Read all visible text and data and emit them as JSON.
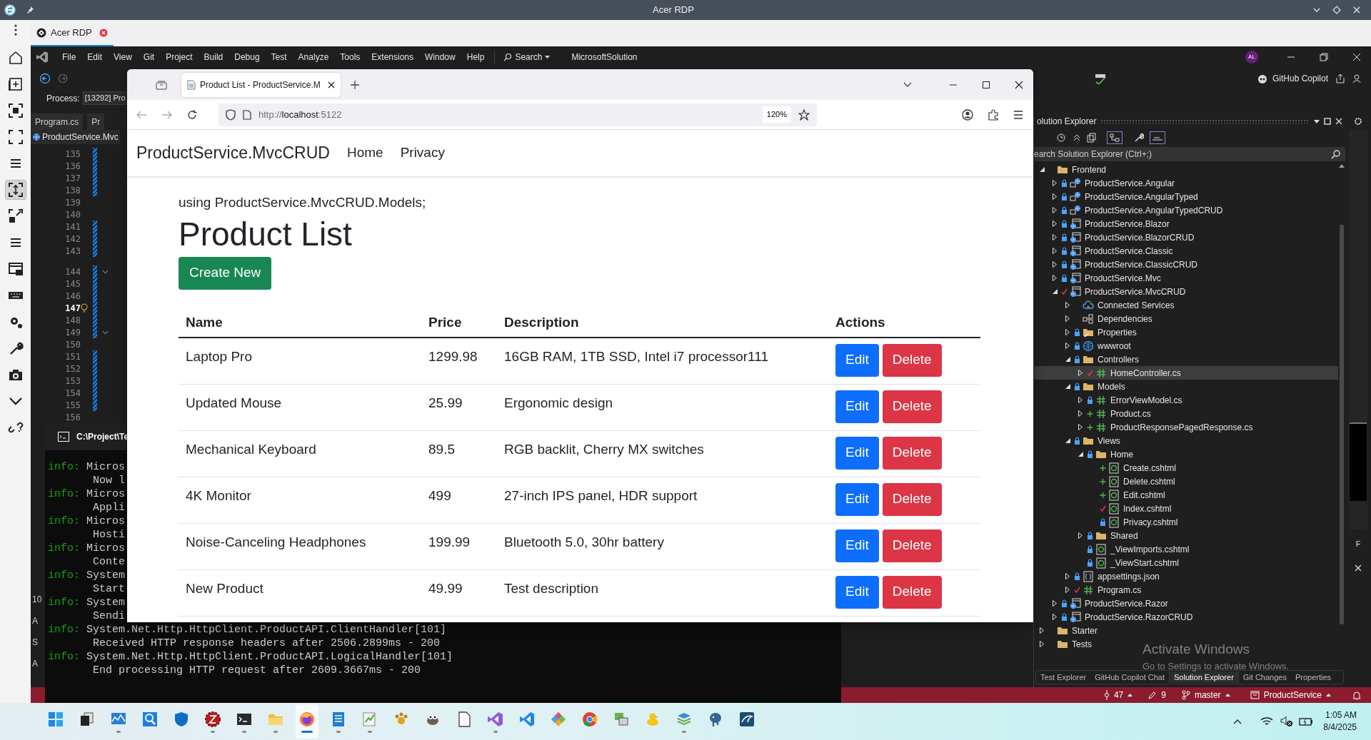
{
  "rdp": {
    "title": "Acer RDP",
    "tab_label": "Acer RDP",
    "toolbar": [
      {
        "kind": "home",
        "selected": false
      },
      {
        "kind": "add",
        "selected": false
      },
      {
        "kind": "focus",
        "selected": false
      },
      {
        "kind": "frame",
        "selected": false
      },
      {
        "kind": "lines",
        "selected": false
      },
      {
        "kind": "fit",
        "selected": true
      },
      {
        "kind": "expand",
        "selected": false
      },
      {
        "kind": "lines",
        "selected": false
      },
      {
        "kind": "windows",
        "selected": false
      },
      {
        "kind": "keyboard",
        "selected": false
      },
      {
        "kind": "gears",
        "selected": false
      },
      {
        "kind": "wrench",
        "selected": false
      },
      {
        "kind": "camera",
        "selected": false
      },
      {
        "kind": "chevron",
        "selected": false
      },
      {
        "kind": "link",
        "selected": false
      }
    ]
  },
  "vs": {
    "menu": [
      "File",
      "Edit",
      "View",
      "Git",
      "Project",
      "Build",
      "Debug",
      "Test",
      "Analyze",
      "Tools",
      "Extensions",
      "Window",
      "Help"
    ],
    "search": "Search",
    "solution_name": "MicrosoftSolution",
    "avatar": "AL",
    "copilot": "GitHub Copilot",
    "process_label": "Process:",
    "process_value": "[13292] Pro",
    "doc_tabs": [
      "Program.cs",
      "Pr"
    ],
    "file_tab": "ProductService.Mvc",
    "line_numbers": [
      {
        "number": "135",
        "changed": true,
        "current": false,
        "foldable": false
      },
      {
        "number": "136",
        "changed": true,
        "current": false,
        "foldable": false
      },
      {
        "number": "137",
        "changed": true,
        "current": false,
        "foldable": false
      },
      {
        "number": "138",
        "changed": true,
        "current": false,
        "foldable": false
      },
      {
        "number": "139",
        "changed": false,
        "current": false,
        "foldable": false
      },
      {
        "number": "140",
        "changed": false,
        "current": false,
        "foldable": false
      },
      {
        "number": "141",
        "changed": true,
        "current": false,
        "foldable": false
      },
      {
        "number": "142",
        "changed": true,
        "current": false,
        "foldable": false
      },
      {
        "number": "143",
        "changed": true,
        "current": false,
        "foldable": false
      },
      {
        "number": "144",
        "changed": true,
        "current": false,
        "foldable": true
      },
      {
        "number": "145",
        "changed": true,
        "current": false,
        "foldable": false
      },
      {
        "number": "146",
        "changed": true,
        "current": false,
        "foldable": false
      },
      {
        "number": "147",
        "changed": true,
        "current": true,
        "foldable": false
      },
      {
        "number": "148",
        "changed": true,
        "current": false,
        "foldable": false
      },
      {
        "number": "149",
        "changed": true,
        "current": false,
        "foldable": true
      },
      {
        "number": "150",
        "changed": false,
        "current": false,
        "foldable": false
      },
      {
        "number": "151",
        "changed": true,
        "current": false,
        "foldable": false
      },
      {
        "number": "152",
        "changed": true,
        "current": false,
        "foldable": false
      },
      {
        "number": "153",
        "changed": true,
        "current": false,
        "foldable": false
      },
      {
        "number": "154",
        "changed": true,
        "current": false,
        "foldable": false
      },
      {
        "number": "155",
        "changed": true,
        "current": false,
        "foldable": false
      },
      {
        "number": "156",
        "changed": false,
        "current": false,
        "foldable": false
      }
    ],
    "hidden_panel_fragments": [
      "10",
      "A",
      "S",
      "A"
    ],
    "right_fragment": "F"
  },
  "browser": {
    "tab_title": "Product List - ProductService.M",
    "url_prefix": "http://",
    "url_host": "localhost",
    "url_port": ":5122",
    "zoom": "120%",
    "page": {
      "brand": "ProductService.MvcCRUD",
      "nav": [
        "Home",
        "Privacy"
      ],
      "using_line": "using ProductService.MvcCRUD.Models;",
      "heading": "Product List",
      "create_button": "Create New",
      "columns": [
        "Name",
        "Price",
        "Description",
        "Actions"
      ],
      "rows": [
        {
          "name": "Laptop Pro",
          "price": "1299.98",
          "description": "16GB RAM, 1TB SSD, Intel i7 processor111",
          "actions": [
            "Edit",
            "Delete"
          ]
        },
        {
          "name": "Updated Mouse",
          "price": "25.99",
          "description": "Ergonomic design",
          "actions": [
            "Edit",
            "Delete"
          ]
        },
        {
          "name": "Mechanical Keyboard",
          "price": "89.5",
          "description": "RGB backlit, Cherry MX switches",
          "actions": [
            "Edit",
            "Delete"
          ]
        },
        {
          "name": "4K Monitor",
          "price": "499",
          "description": "27-inch IPS panel, HDR support",
          "actions": [
            "Edit",
            "Delete"
          ]
        },
        {
          "name": "Noise-Canceling Headphones",
          "price": "199.99",
          "description": "Bluetooth 5.0, 30hr battery",
          "actions": [
            "Edit",
            "Delete"
          ]
        },
        {
          "name": "New Product",
          "price": "49.99",
          "description": "Test description",
          "actions": [
            "Edit",
            "Delete"
          ]
        }
      ]
    }
  },
  "terminal": {
    "title": "C:\\Project\\Te",
    "entries": [
      {
        "level": "info:",
        "source": "Micros",
        "message": "Now l"
      },
      {
        "level": "info:",
        "source": "Micros",
        "message": "Appli"
      },
      {
        "level": "info:",
        "source": "Micros",
        "message": "Hosti"
      },
      {
        "level": "info:",
        "source": "Micros",
        "message": "Conte"
      },
      {
        "level": "info:",
        "source": "System",
        "message": "Start"
      },
      {
        "level": "info:",
        "source": "System",
        "message": "Sendi"
      },
      {
        "level": "info:",
        "source": "System.Net.Http.HttpClient.ProductAPI.ClientHandler[101]",
        "message": "Received HTTP response headers after 2506.2899ms - 200"
      },
      {
        "level": "info:",
        "source": "System.Net.Http.HttpClient.ProductAPI.LogicalHandler[101]",
        "message": "End processing HTTP request after 2609.3667ms - 200"
      }
    ]
  },
  "solution_explorer": {
    "title": "olution Explorer",
    "search_placeholder": "earch Solution Explorer (Ctrl+;)",
    "tree": [
      {
        "label": "Frontend",
        "kind": "folder",
        "locked": false,
        "modified": false,
        "added": false,
        "selected": false,
        "expanded": true,
        "children": [
          {
            "label": "ProductService.Angular",
            "kind": "web-project",
            "locked": true,
            "modified": false,
            "added": false,
            "selected": false,
            "expanded": false
          },
          {
            "label": "ProductService.AngularTyped",
            "kind": "web-project",
            "locked": true,
            "modified": false,
            "added": false,
            "selected": false,
            "expanded": false
          },
          {
            "label": "ProductService.AngularTypedCRUD",
            "kind": "web-project",
            "locked": true,
            "modified": false,
            "added": false,
            "selected": false,
            "expanded": false
          },
          {
            "label": "ProductService.Blazor",
            "kind": "project",
            "locked": true,
            "modified": false,
            "added": false,
            "selected": false,
            "expanded": false
          },
          {
            "label": "ProductService.BlazorCRUD",
            "kind": "project",
            "locked": true,
            "modified": false,
            "added": false,
            "selected": false,
            "expanded": false
          },
          {
            "label": "ProductService.Classic",
            "kind": "project",
            "locked": true,
            "modified": false,
            "added": false,
            "selected": false,
            "expanded": false
          },
          {
            "label": "ProductService.ClassicCRUD",
            "kind": "project",
            "locked": true,
            "modified": false,
            "added": false,
            "selected": false,
            "expanded": false
          },
          {
            "label": "ProductService.Mvc",
            "kind": "project",
            "locked": true,
            "modified": false,
            "added": false,
            "selected": false,
            "expanded": false
          },
          {
            "label": "ProductService.MvcCRUD",
            "kind": "project",
            "locked": false,
            "modified": true,
            "added": false,
            "selected": false,
            "expanded": true,
            "children": [
              {
                "label": "Connected Services",
                "kind": "cloud",
                "locked": false,
                "modified": false,
                "added": false,
                "selected": false,
                "expanded": false
              },
              {
                "label": "Dependencies",
                "kind": "dependencies",
                "locked": false,
                "modified": false,
                "added": false,
                "selected": false,
                "expanded": false
              },
              {
                "label": "Properties",
                "kind": "properties",
                "locked": true,
                "modified": false,
                "added": false,
                "selected": false,
                "expanded": false
              },
              {
                "label": "wwwroot",
                "kind": "globe",
                "locked": true,
                "modified": false,
                "added": false,
                "selected": false,
                "expanded": false
              },
              {
                "label": "Controllers",
                "kind": "folder",
                "locked": true,
                "modified": false,
                "added": false,
                "selected": false,
                "expanded": true,
                "children": [
                  {
                    "label": "HomeController.cs",
                    "kind": "csharp",
                    "locked": false,
                    "modified": true,
                    "added": false,
                    "selected": true,
                    "expanded": false
                  }
                ]
              },
              {
                "label": "Models",
                "kind": "folder",
                "locked": true,
                "modified": false,
                "added": false,
                "selected": false,
                "expanded": true,
                "children": [
                  {
                    "label": "ErrorViewModel.cs",
                    "kind": "csharp",
                    "locked": true,
                    "modified": false,
                    "added": false,
                    "selected": false,
                    "expanded": false
                  },
                  {
                    "label": "Product.cs",
                    "kind": "csharp",
                    "locked": false,
                    "modified": false,
                    "added": true,
                    "selected": false,
                    "expanded": false
                  },
                  {
                    "label": "ProductResponsePagedResponse.cs",
                    "kind": "csharp",
                    "locked": false,
                    "modified": false,
                    "added": true,
                    "selected": false,
                    "expanded": false
                  }
                ]
              },
              {
                "label": "Views",
                "kind": "folder",
                "locked": true,
                "modified": false,
                "added": false,
                "selected": false,
                "expanded": true,
                "children": [
                  {
                    "label": "Home",
                    "kind": "folder",
                    "locked": true,
                    "modified": false,
                    "added": false,
                    "selected": false,
                    "expanded": true,
                    "children": [
                      {
                        "label": "Create.cshtml",
                        "kind": "razor",
                        "locked": false,
                        "modified": false,
                        "added": true,
                        "selected": false
                      },
                      {
                        "label": "Delete.cshtml",
                        "kind": "razor",
                        "locked": false,
                        "modified": false,
                        "added": true,
                        "selected": false
                      },
                      {
                        "label": "Edit.cshtml",
                        "kind": "razor",
                        "locked": false,
                        "modified": false,
                        "added": true,
                        "selected": false
                      },
                      {
                        "label": "Index.cshtml",
                        "kind": "razor",
                        "locked": false,
                        "modified": true,
                        "added": false,
                        "selected": false
                      },
                      {
                        "label": "Privacy.cshtml",
                        "kind": "razor",
                        "locked": true,
                        "modified": false,
                        "added": false,
                        "selected": false
                      }
                    ]
                  },
                  {
                    "label": "Shared",
                    "kind": "folder",
                    "locked": true,
                    "modified": false,
                    "added": false,
                    "selected": false,
                    "expanded": false
                  },
                  {
                    "label": "_ViewImports.cshtml",
                    "kind": "razor",
                    "locked": true,
                    "modified": false,
                    "added": false,
                    "selected": false
                  },
                  {
                    "label": "_ViewStart.cshtml",
                    "kind": "razor",
                    "locked": true,
                    "modified": false,
                    "added": false,
                    "selected": false
                  }
                ]
              },
              {
                "label": "appsettings.json",
                "kind": "json",
                "locked": true,
                "modified": false,
                "added": false,
                "selected": false,
                "expanded": false
              },
              {
                "label": "Program.cs",
                "kind": "csharp",
                "locked": false,
                "modified": true,
                "added": false,
                "selected": false,
                "expanded": false
              }
            ]
          },
          {
            "label": "ProductService.Razor",
            "kind": "project",
            "locked": true,
            "modified": false,
            "added": false,
            "selected": false,
            "expanded": false
          },
          {
            "label": "ProductService.RazorCRUD",
            "kind": "project",
            "locked": true,
            "modified": false,
            "added": false,
            "selected": false,
            "expanded": false
          }
        ]
      },
      {
        "label": "Starter",
        "kind": "folder",
        "locked": false,
        "modified": false,
        "added": false,
        "selected": false,
        "expanded": false
      },
      {
        "label": "Tests",
        "kind": "folder",
        "locked": false,
        "modified": false,
        "added": false,
        "selected": false,
        "expanded": false
      }
    ],
    "bottom_tabs": [
      {
        "label": "Test Explorer",
        "selected": false
      },
      {
        "label": "GitHub Copilot Chat",
        "selected": false
      },
      {
        "label": "Solution Explorer",
        "selected": true
      },
      {
        "label": "Git Changes",
        "selected": false
      },
      {
        "label": "Properties",
        "selected": false
      }
    ]
  },
  "activation_notice": {
    "title": "Activate Windows",
    "message": "Go to Settings to activate Windows."
  },
  "status_bar": {
    "commits": "47",
    "changes": "9",
    "branch": "master",
    "repository": "ProductService"
  },
  "taskbar": {
    "apps": [
      {
        "kind": "start",
        "running": false,
        "selected": false
      },
      {
        "kind": "task-view",
        "running": false,
        "selected": false
      },
      {
        "kind": "monitor",
        "running": true,
        "selected": false
      },
      {
        "kind": "search",
        "running": false,
        "selected": false
      },
      {
        "kind": "shield",
        "running": false,
        "selected": false
      },
      {
        "kind": "ftp",
        "running": true,
        "selected": false
      },
      {
        "kind": "terminal",
        "running": true,
        "selected": false
      },
      {
        "kind": "folder",
        "running": true,
        "selected": false
      },
      {
        "kind": "firefox",
        "running": true,
        "selected": true
      },
      {
        "kind": "notepad",
        "running": true,
        "selected": false
      },
      {
        "kind": "notepad-plus",
        "running": true,
        "selected": false
      },
      {
        "kind": "paw",
        "running": false,
        "selected": false
      },
      {
        "kind": "gimp",
        "running": false,
        "selected": false
      },
      {
        "kind": "document",
        "running": false,
        "selected": false
      },
      {
        "kind": "visual-studio",
        "running": true,
        "selected": false
      },
      {
        "kind": "vscode",
        "running": false,
        "selected": false
      },
      {
        "kind": "diamond",
        "running": false,
        "selected": false
      },
      {
        "kind": "chrome",
        "running": false,
        "selected": false
      },
      {
        "kind": "network",
        "running": false,
        "selected": false
      },
      {
        "kind": "duck",
        "running": false,
        "selected": false
      },
      {
        "kind": "stack",
        "running": true,
        "selected": false
      },
      {
        "kind": "elephant",
        "running": false,
        "selected": false
      },
      {
        "kind": "dolphin",
        "running": false,
        "selected": false
      }
    ],
    "time": "1:05 AM",
    "date": "8/4/2025"
  }
}
